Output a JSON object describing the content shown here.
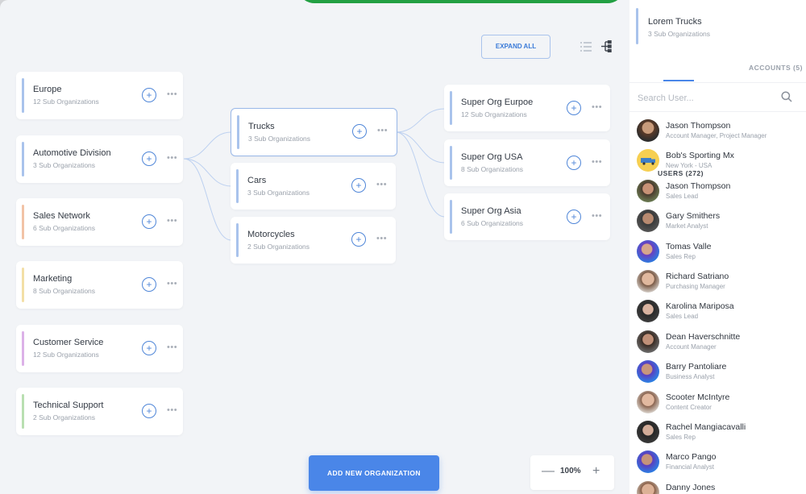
{
  "toolbar": {
    "expand_all": "EXPAND ALL"
  },
  "level1": [
    {
      "title": "Europe",
      "sub": "12 Sub Organizations",
      "accent": "#a9c3ec"
    },
    {
      "title": "Automotive Division",
      "sub": "3 Sub Organizations",
      "accent": "#a9c3ec"
    },
    {
      "title": "Sales Network",
      "sub": "6 Sub Organizations",
      "accent": "#f2c3a6"
    },
    {
      "title": "Marketing",
      "sub": "8 Sub Organizations",
      "accent": "#f3dfa6"
    },
    {
      "title": "Customer Service",
      "sub": "12 Sub Organizations",
      "accent": "#dcb1e8"
    },
    {
      "title": "Technical Support",
      "sub": "2 Sub Organizations",
      "accent": "#b9dfb1"
    }
  ],
  "level2": [
    {
      "title": "Trucks",
      "sub": "3 Sub Organizations",
      "accent": "#a9c3ec"
    },
    {
      "title": "Cars",
      "sub": "3 Sub Organizations",
      "accent": "#a9c3ec"
    },
    {
      "title": "Motorcycles",
      "sub": "2 Sub Organizations",
      "accent": "#a9c3ec"
    }
  ],
  "level3": [
    {
      "title": "Super Org Eurpoe",
      "sub": "12 Sub Organizations",
      "accent": "#a9c3ec"
    },
    {
      "title": "Super Org USA",
      "sub": "8 Sub Organizations",
      "accent": "#a9c3ec"
    },
    {
      "title": "Super Org Asia",
      "sub": "6 Sub Organizations",
      "accent": "#a9c3ec"
    }
  ],
  "actions": {
    "plus": "+",
    "more": "•••"
  },
  "footer": {
    "add_new": "ADD NEW ORGANIZATION",
    "zoom_value": "100%",
    "zoom_minus": "—",
    "zoom_plus": "+"
  },
  "panel": {
    "org_title": "Lorem Trucks",
    "org_sub": "3 Sub Organizations",
    "tab_users": "USERS (272)",
    "tab_accounts": "ACCOUNTS (5)",
    "search_placeholder": "Search User...",
    "users": [
      {
        "name": "Jason Thompson",
        "role": "Account Manager, Project Manager"
      },
      {
        "name": "Bob's Sporting Mx",
        "role": "New York - USA"
      },
      {
        "name": "Jason Thompson",
        "role": "Sales Lead"
      },
      {
        "name": "Gary Smithers",
        "role": "Market Analyst"
      },
      {
        "name": "Tomas Valle",
        "role": "Sales Rep"
      },
      {
        "name": "Richard Satriano",
        "role": "Purchasing Manager"
      },
      {
        "name": "Karolina Mariposa",
        "role": "Sales Lead"
      },
      {
        "name": "Dean Haverschnitte",
        "role": "Account Manager"
      },
      {
        "name": "Barry Pantoliare",
        "role": "Business Analyst"
      },
      {
        "name": "Scooter McIntyre",
        "role": "Content Creator"
      },
      {
        "name": "Rachel Mangiacavalli",
        "role": "Sales Rep"
      },
      {
        "name": "Marco Pango",
        "role": "Financial Analyst"
      },
      {
        "name": "Danny Jones",
        "role": ""
      }
    ]
  }
}
